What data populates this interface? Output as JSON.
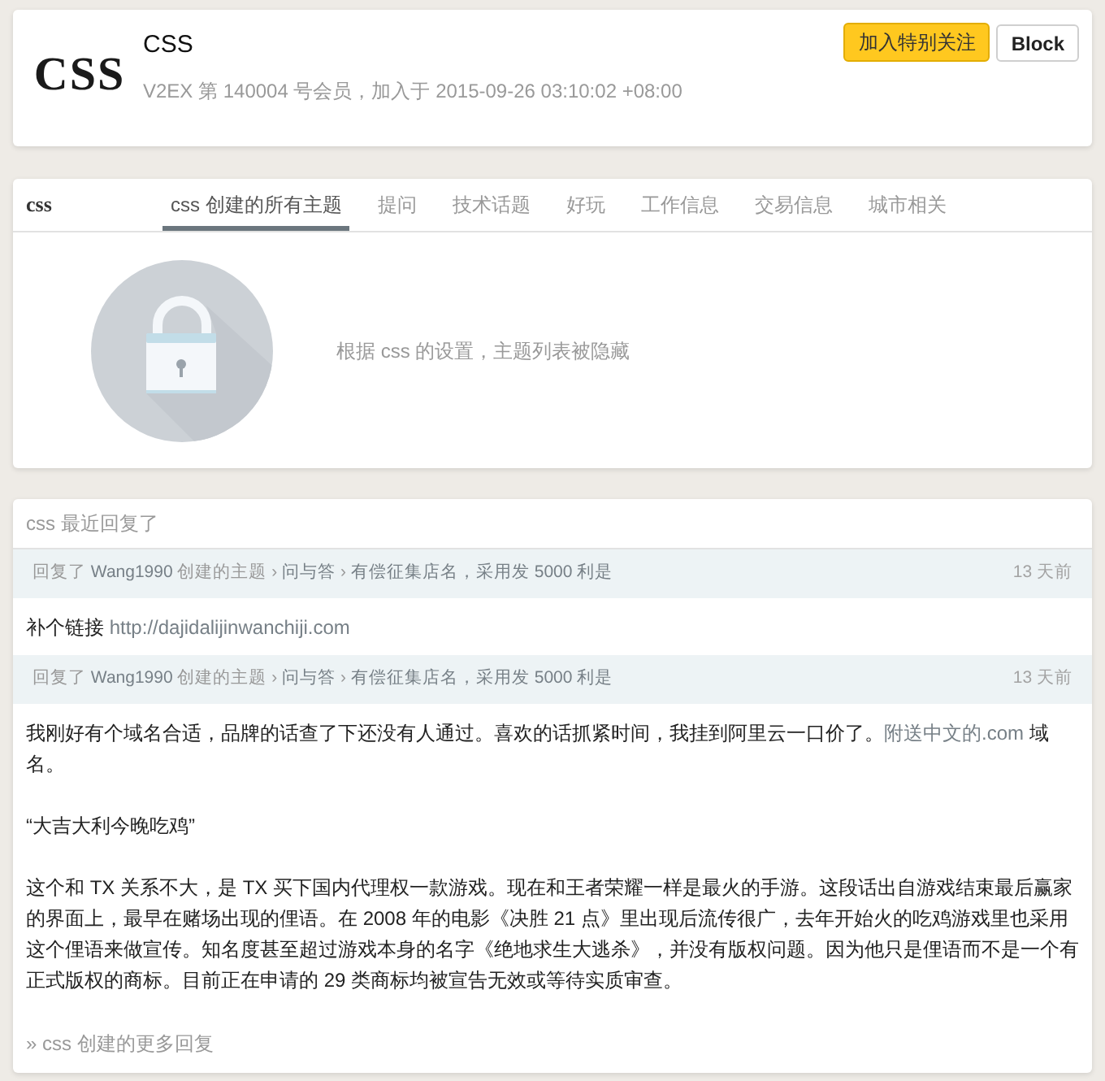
{
  "profile": {
    "avatar_text": "CSS",
    "username": "CSS",
    "meta": "V2EX 第 140004 号会员，加入于 2015-09-26 03:10:02 +08:00",
    "buttons": [
      {
        "label": "加入特别关注",
        "kind": "primary"
      },
      {
        "label": "Block",
        "kind": "default"
      }
    ]
  },
  "topics": {
    "label": "css",
    "tabs": [
      {
        "label": "css 创建的所有主题",
        "selected": true
      },
      {
        "label": "提问",
        "selected": false
      },
      {
        "label": "技术话题",
        "selected": false
      },
      {
        "label": "好玩",
        "selected": false
      },
      {
        "label": "工作信息",
        "selected": false
      },
      {
        "label": "交易信息",
        "selected": false
      },
      {
        "label": "城市相关",
        "selected": false
      }
    ],
    "notice": "根据 css 的设置，主题列表被隐藏"
  },
  "replies": {
    "title": "css 最近回复了",
    "items": [
      {
        "header": [
          {
            "kind": "text",
            "text": "回复了"
          },
          {
            "kind": "user",
            "text": "Wang1990"
          },
          {
            "kind": "text",
            "text": "创建的主题"
          },
          {
            "kind": "sep",
            "text": "›"
          },
          {
            "kind": "node",
            "text": "问与答"
          },
          {
            "kind": "sep",
            "text": "›"
          },
          {
            "kind": "topic",
            "text": "有偿征集店名，采用发 5000 利是"
          }
        ],
        "time": "13 天前",
        "paragraphs": [
          [
            {
              "kind": "text",
              "text": "补个链接 "
            },
            {
              "kind": "link",
              "text": "http://dajidalijinwanchiji.com"
            }
          ]
        ]
      },
      {
        "header": [
          {
            "kind": "text",
            "text": "回复了"
          },
          {
            "kind": "user",
            "text": "Wang1990"
          },
          {
            "kind": "text",
            "text": "创建的主题"
          },
          {
            "kind": "sep",
            "text": "›"
          },
          {
            "kind": "node",
            "text": "问与答"
          },
          {
            "kind": "sep",
            "text": "›"
          },
          {
            "kind": "topic",
            "text": "有偿征集店名，采用发 5000 利是"
          }
        ],
        "time": "13 天前",
        "paragraphs": [
          [
            {
              "kind": "text",
              "text": "我刚好有个域名合适，品牌的话查了下还没有人通过。喜欢的话抓紧时间，我挂到阿里云一口价了。"
            },
            {
              "kind": "link",
              "text": "附送中文的.com"
            },
            {
              "kind": "text",
              "text": " 域名。"
            }
          ],
          [
            {
              "kind": "text",
              "text": "“大吉大利今晚吃鸡”"
            }
          ],
          [
            {
              "kind": "text",
              "text": "这个和 TX 关系不大，是 TX 买下国内代理权一款游戏。现在和王者荣耀一样是最火的手游。这段话出自游戏结束最后赢家的界面上，最早在赌场出现的俚语。在 2008 年的电影《决胜 21 点》里出现后流传很广，去年开始火的吃鸡游戏里也采用这个俚语来做宣传。知名度甚至超过游戏本身的名字《绝地求生大逃杀》，并没有版权问题。因为他只是俚语而不是一个有正式版权的商标。目前正在申请的 29 类商标均被宣告无效或等待实质审查。"
            }
          ]
        ]
      }
    ],
    "more": "» css 创建的更多回复"
  }
}
